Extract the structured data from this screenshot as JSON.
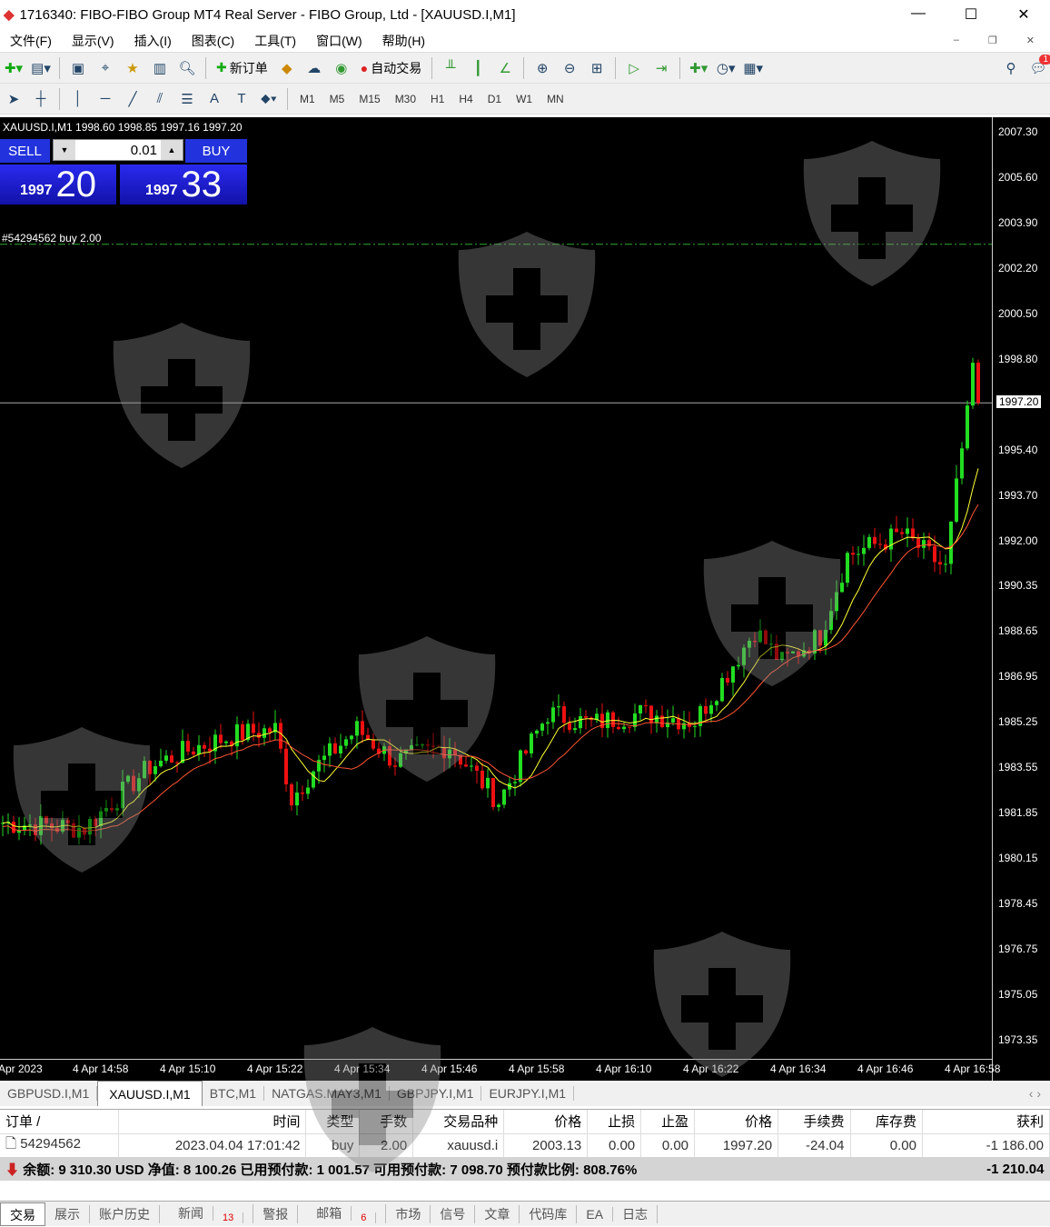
{
  "window": {
    "title": "1716340: FIBO-FIBO Group MT4 Real Server - FIBO Group, Ltd - [XAUUSD.I,M1]",
    "minimize": "—",
    "maximize": "☐",
    "close": "✕"
  },
  "menu": [
    "文件(F)",
    "显示(V)",
    "插入(I)",
    "图表(C)",
    "工具(T)",
    "窗口(W)",
    "帮助(H)"
  ],
  "toolbar": {
    "new_order": "新订单",
    "auto_trading": "自动交易",
    "notification_count": "1"
  },
  "timeframes": [
    "M1",
    "M5",
    "M15",
    "M30",
    "H1",
    "H4",
    "D1",
    "W1",
    "MN"
  ],
  "chart": {
    "symbol_info": "XAUUSD.I,M1  1998.60 1998.85 1997.16 1997.20",
    "sell_label": "SELL",
    "buy_label": "BUY",
    "lot": "0.01",
    "bid_small": "1997",
    "bid_big": "20",
    "ask_small": "1997",
    "ask_big": "33",
    "order_label": "#54294562 buy 2.00",
    "current_price": "1997.20"
  },
  "chart_data": {
    "type": "candlestick",
    "symbol": "XAUUSD.I",
    "timeframe": "M1",
    "ylim": [
      1972.5,
      2008.5
    ],
    "price_ticks": [
      "2007.30",
      "2005.60",
      "2003.90",
      "2002.20",
      "2000.50",
      "1998.80",
      "1995.40",
      "1993.70",
      "1992.00",
      "1990.35",
      "1988.65",
      "1986.95",
      "1985.25",
      "1983.55",
      "1981.85",
      "1980.15",
      "1978.45",
      "1976.75",
      "1975.05",
      "1973.35"
    ],
    "time_ticks": [
      "Apr 2023",
      "4 Apr 14:58",
      "4 Apr 15:10",
      "4 Apr 15:22",
      "4 Apr 15:34",
      "4 Apr 15:46",
      "4 Apr 15:58",
      "4 Apr 16:10",
      "4 Apr 16:22",
      "4 Apr 16:34",
      "4 Apr 16:46",
      "4 Apr 16:58"
    ],
    "close_keypoints": [
      [
        0,
        1981.5
      ],
      [
        15,
        1981.3
      ],
      [
        27,
        1983.6
      ],
      [
        35,
        1984.3
      ],
      [
        43,
        1984.8
      ],
      [
        50,
        1985.0
      ],
      [
        53,
        1982.4
      ],
      [
        57,
        1983.5
      ],
      [
        65,
        1985.0
      ],
      [
        72,
        1983.8
      ],
      [
        82,
        1984.4
      ],
      [
        91,
        1982.3
      ],
      [
        97,
        1984.5
      ],
      [
        100,
        1985.6
      ],
      [
        108,
        1985.2
      ],
      [
        117,
        1985.6
      ],
      [
        127,
        1985.3
      ],
      [
        132,
        1986.8
      ],
      [
        138,
        1988.7
      ],
      [
        143,
        1987.5
      ],
      [
        150,
        1988.5
      ],
      [
        155,
        1991.5
      ],
      [
        165,
        1992.3
      ],
      [
        173,
        1991.0
      ],
      [
        176,
        1995.5
      ],
      [
        178,
        1998.7
      ],
      [
        179,
        1997.2
      ]
    ],
    "order_price": 2003.13,
    "current_price": 1997.2,
    "ma_series": [
      "MA fast (yellow)",
      "MA slow (red)"
    ]
  },
  "chart_tabs": [
    "GBPUSD.I,M1",
    "XAUUSD.I,M1",
    "BTC,M1",
    "NATGAS.MAY3,M1",
    "GBPJPY.I,M1",
    "EURJPY.I,M1"
  ],
  "terminal": {
    "headers": [
      "订单 /",
      "时间",
      "类型",
      "手数",
      "交易品种",
      "价格",
      "止损",
      "止盈",
      "价格",
      "手续费",
      "库存费",
      "获利"
    ],
    "rows": [
      [
        "54294562",
        "2023.04.04 17:01:42",
        "buy",
        "2.00",
        "xauusd.i",
        "2003.13",
        "0.00",
        "0.00",
        "1997.20",
        "-24.04",
        "0.00",
        "-1 186.00"
      ]
    ],
    "summary": "余额: 9 310.30 USD  净值: 8 100.26  已用预付款: 1 001.57  可用预付款: 7 098.70  预付款比例: 808.76%",
    "total": "-1 210.04"
  },
  "bottom_tabs": [
    {
      "label": "交易"
    },
    {
      "label": "展示"
    },
    {
      "label": "账户历史"
    },
    {
      "label": "新闻",
      "badge": "13"
    },
    {
      "label": "警报"
    },
    {
      "label": "邮箱",
      "badge": "6"
    },
    {
      "label": "市场"
    },
    {
      "label": "信号"
    },
    {
      "label": "文章"
    },
    {
      "label": "代码库"
    },
    {
      "label": "EA"
    },
    {
      "label": "日志"
    }
  ]
}
